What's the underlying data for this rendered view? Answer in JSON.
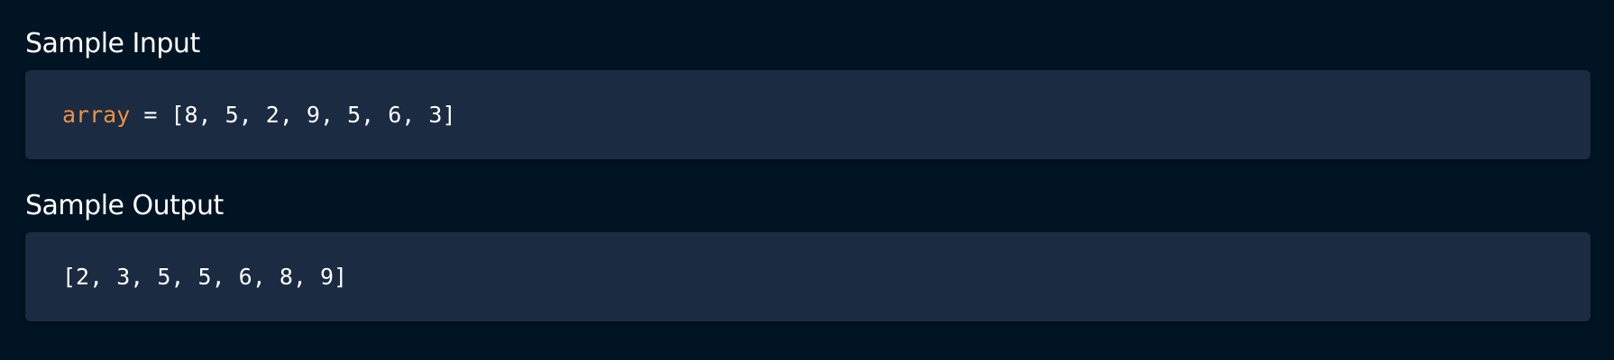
{
  "input_section": {
    "title": "Sample Input",
    "variable": "array",
    "operator": " = ",
    "value": "[8, 5, 2, 9, 5, 6, 3]"
  },
  "output_section": {
    "title": "Sample Output",
    "value": "[2, 3, 5, 5, 6, 8, 9]"
  },
  "colors": {
    "background": "#011424",
    "code_box": "#1a2b42",
    "variable": "#f0913f",
    "text": "#ffffff"
  }
}
